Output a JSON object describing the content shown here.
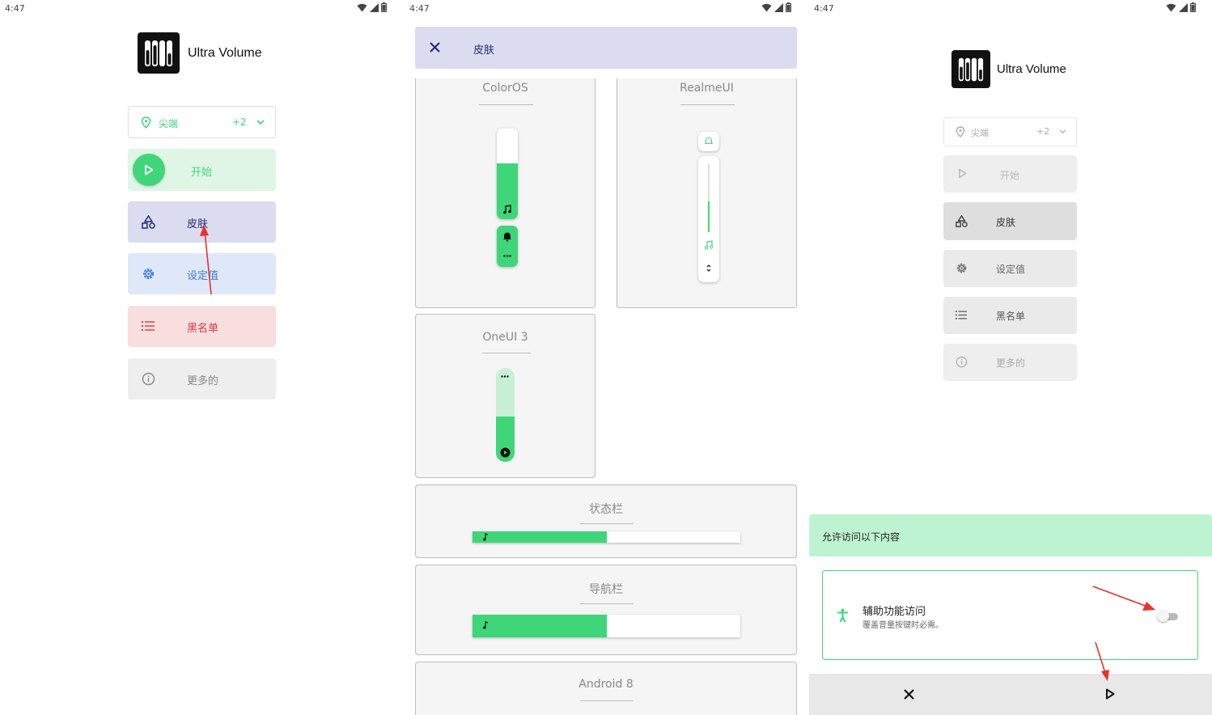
{
  "status": {
    "time": "4:47"
  },
  "app": {
    "name": "Ultra Volume"
  },
  "main": {
    "select": {
      "value": "尖端",
      "count": "+2"
    },
    "buttons": {
      "start": "开始",
      "skin": "皮肤",
      "settings": "设定值",
      "blacklist": "黑名单",
      "more": "更多的"
    }
  },
  "skins": {
    "header_title": "皮肤",
    "items": {
      "coloros": "ColorOS",
      "realmeui": "RealmeUI",
      "oneui": "OneUI 3",
      "statusbar": "状态栏",
      "navbar": "导航栏",
      "android8": "Android 8"
    },
    "progress": {
      "coloros": 0.62,
      "oneui": 0.48,
      "statusbar": 0.5,
      "navbar": 0.5,
      "realme": 0.45
    }
  },
  "dialog": {
    "title": "允许访问以下内容",
    "item_title": "辅助功能访问",
    "item_desc": "覆盖音量按键时必需。"
  },
  "colors": {
    "accent": "#3fd67a",
    "skin_bg": "#dcdcf0",
    "settings_bg": "#dfe8f8",
    "blacklist_bg": "#f9dede",
    "more_bg": "#eeeeee",
    "start_bg": "#dff6e6",
    "arrow": "#e8322a"
  }
}
